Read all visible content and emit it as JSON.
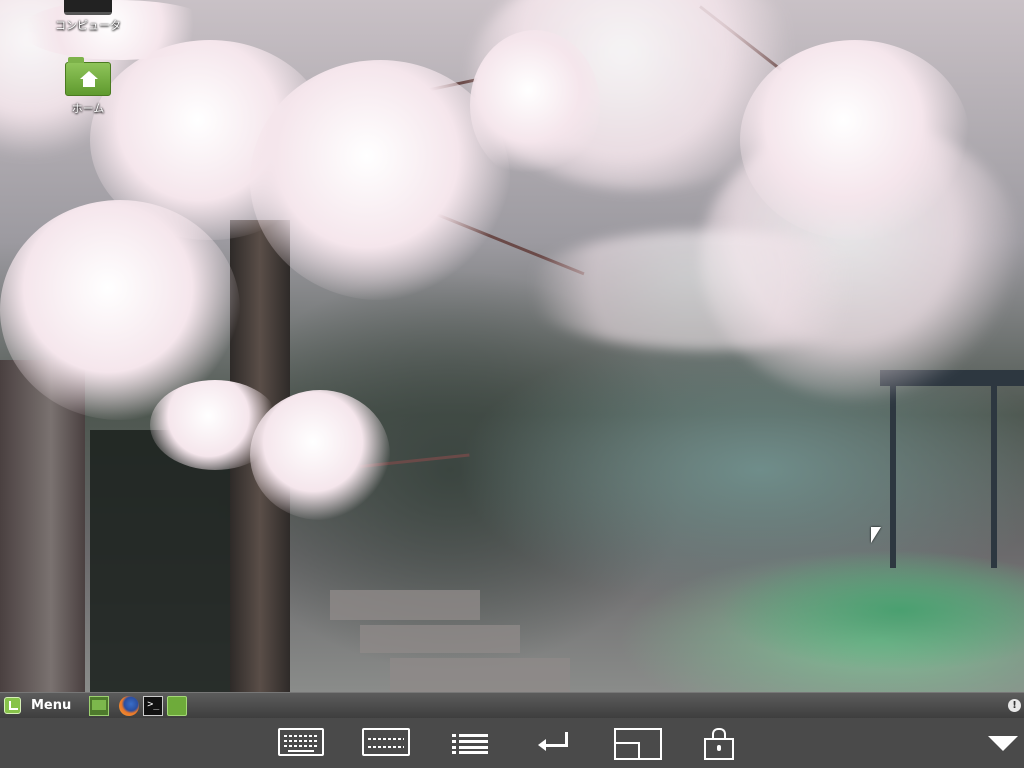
{
  "desktop": {
    "icons": [
      {
        "label": "コンピュータ",
        "icon": "computer-icon"
      },
      {
        "label": "ホーム",
        "icon": "home-folder-icon"
      }
    ]
  },
  "panel": {
    "menu_label": "Menu",
    "launchers": [
      {
        "name": "show-desktop",
        "icon": "show-desktop-icon"
      },
      {
        "name": "firefox",
        "icon": "firefox-icon"
      },
      {
        "name": "terminal",
        "icon": "terminal-icon",
        "glyph": ">_"
      },
      {
        "name": "files",
        "icon": "folder-icon"
      }
    ],
    "tray_alert": "!"
  },
  "toolbar": {
    "buttons": [
      {
        "name": "keyboard",
        "icon": "keyboard-icon"
      },
      {
        "name": "keyboard-compact",
        "icon": "compact-keyboard-icon"
      },
      {
        "name": "menu-list",
        "icon": "list-icon"
      },
      {
        "name": "enter",
        "icon": "enter-icon"
      },
      {
        "name": "window",
        "icon": "window-icon"
      },
      {
        "name": "lock",
        "icon": "lock-icon"
      },
      {
        "name": "collapse",
        "icon": "triangle-down-icon"
      }
    ]
  },
  "colors": {
    "panel_bg": "#4a4a4a",
    "mint_green": "#87c34a",
    "blossom": "#f5e6ec"
  }
}
